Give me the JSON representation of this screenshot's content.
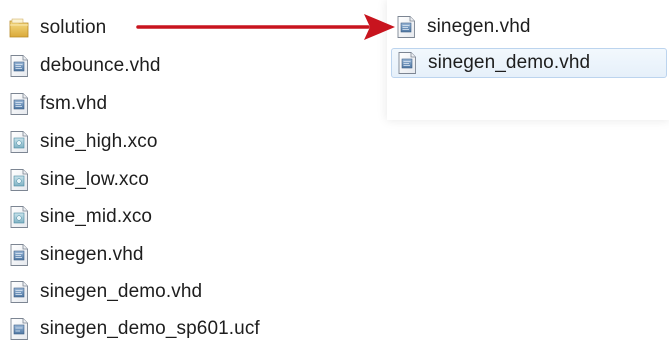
{
  "left_pane": {
    "items": [
      {
        "label": "solution",
        "icon": "folder-icon"
      },
      {
        "label": "debounce.vhd",
        "icon": "vhd-file-icon"
      },
      {
        "label": "fsm.vhd",
        "icon": "vhd-file-icon"
      },
      {
        "label": "sine_high.xco",
        "icon": "xco-file-icon"
      },
      {
        "label": "sine_low.xco",
        "icon": "xco-file-icon"
      },
      {
        "label": "sine_mid.xco",
        "icon": "xco-file-icon"
      },
      {
        "label": "sinegen.vhd",
        "icon": "vhd-file-icon"
      },
      {
        "label": "sinegen_demo.vhd",
        "icon": "vhd-file-icon"
      },
      {
        "label": "sinegen_demo_sp601.ucf",
        "icon": "ucf-file-icon"
      }
    ]
  },
  "right_pane": {
    "items": [
      {
        "label": "sinegen.vhd",
        "icon": "vhd-file-icon"
      },
      {
        "label": "sinegen_demo.vhd",
        "icon": "vhd-file-icon"
      }
    ],
    "selected_index": 1
  },
  "colors": {
    "arrow": "#c8141e",
    "selection_border": "#bcd4ee",
    "folder": "#e8c45a",
    "file_icon_blue": "#6d8fb4"
  }
}
